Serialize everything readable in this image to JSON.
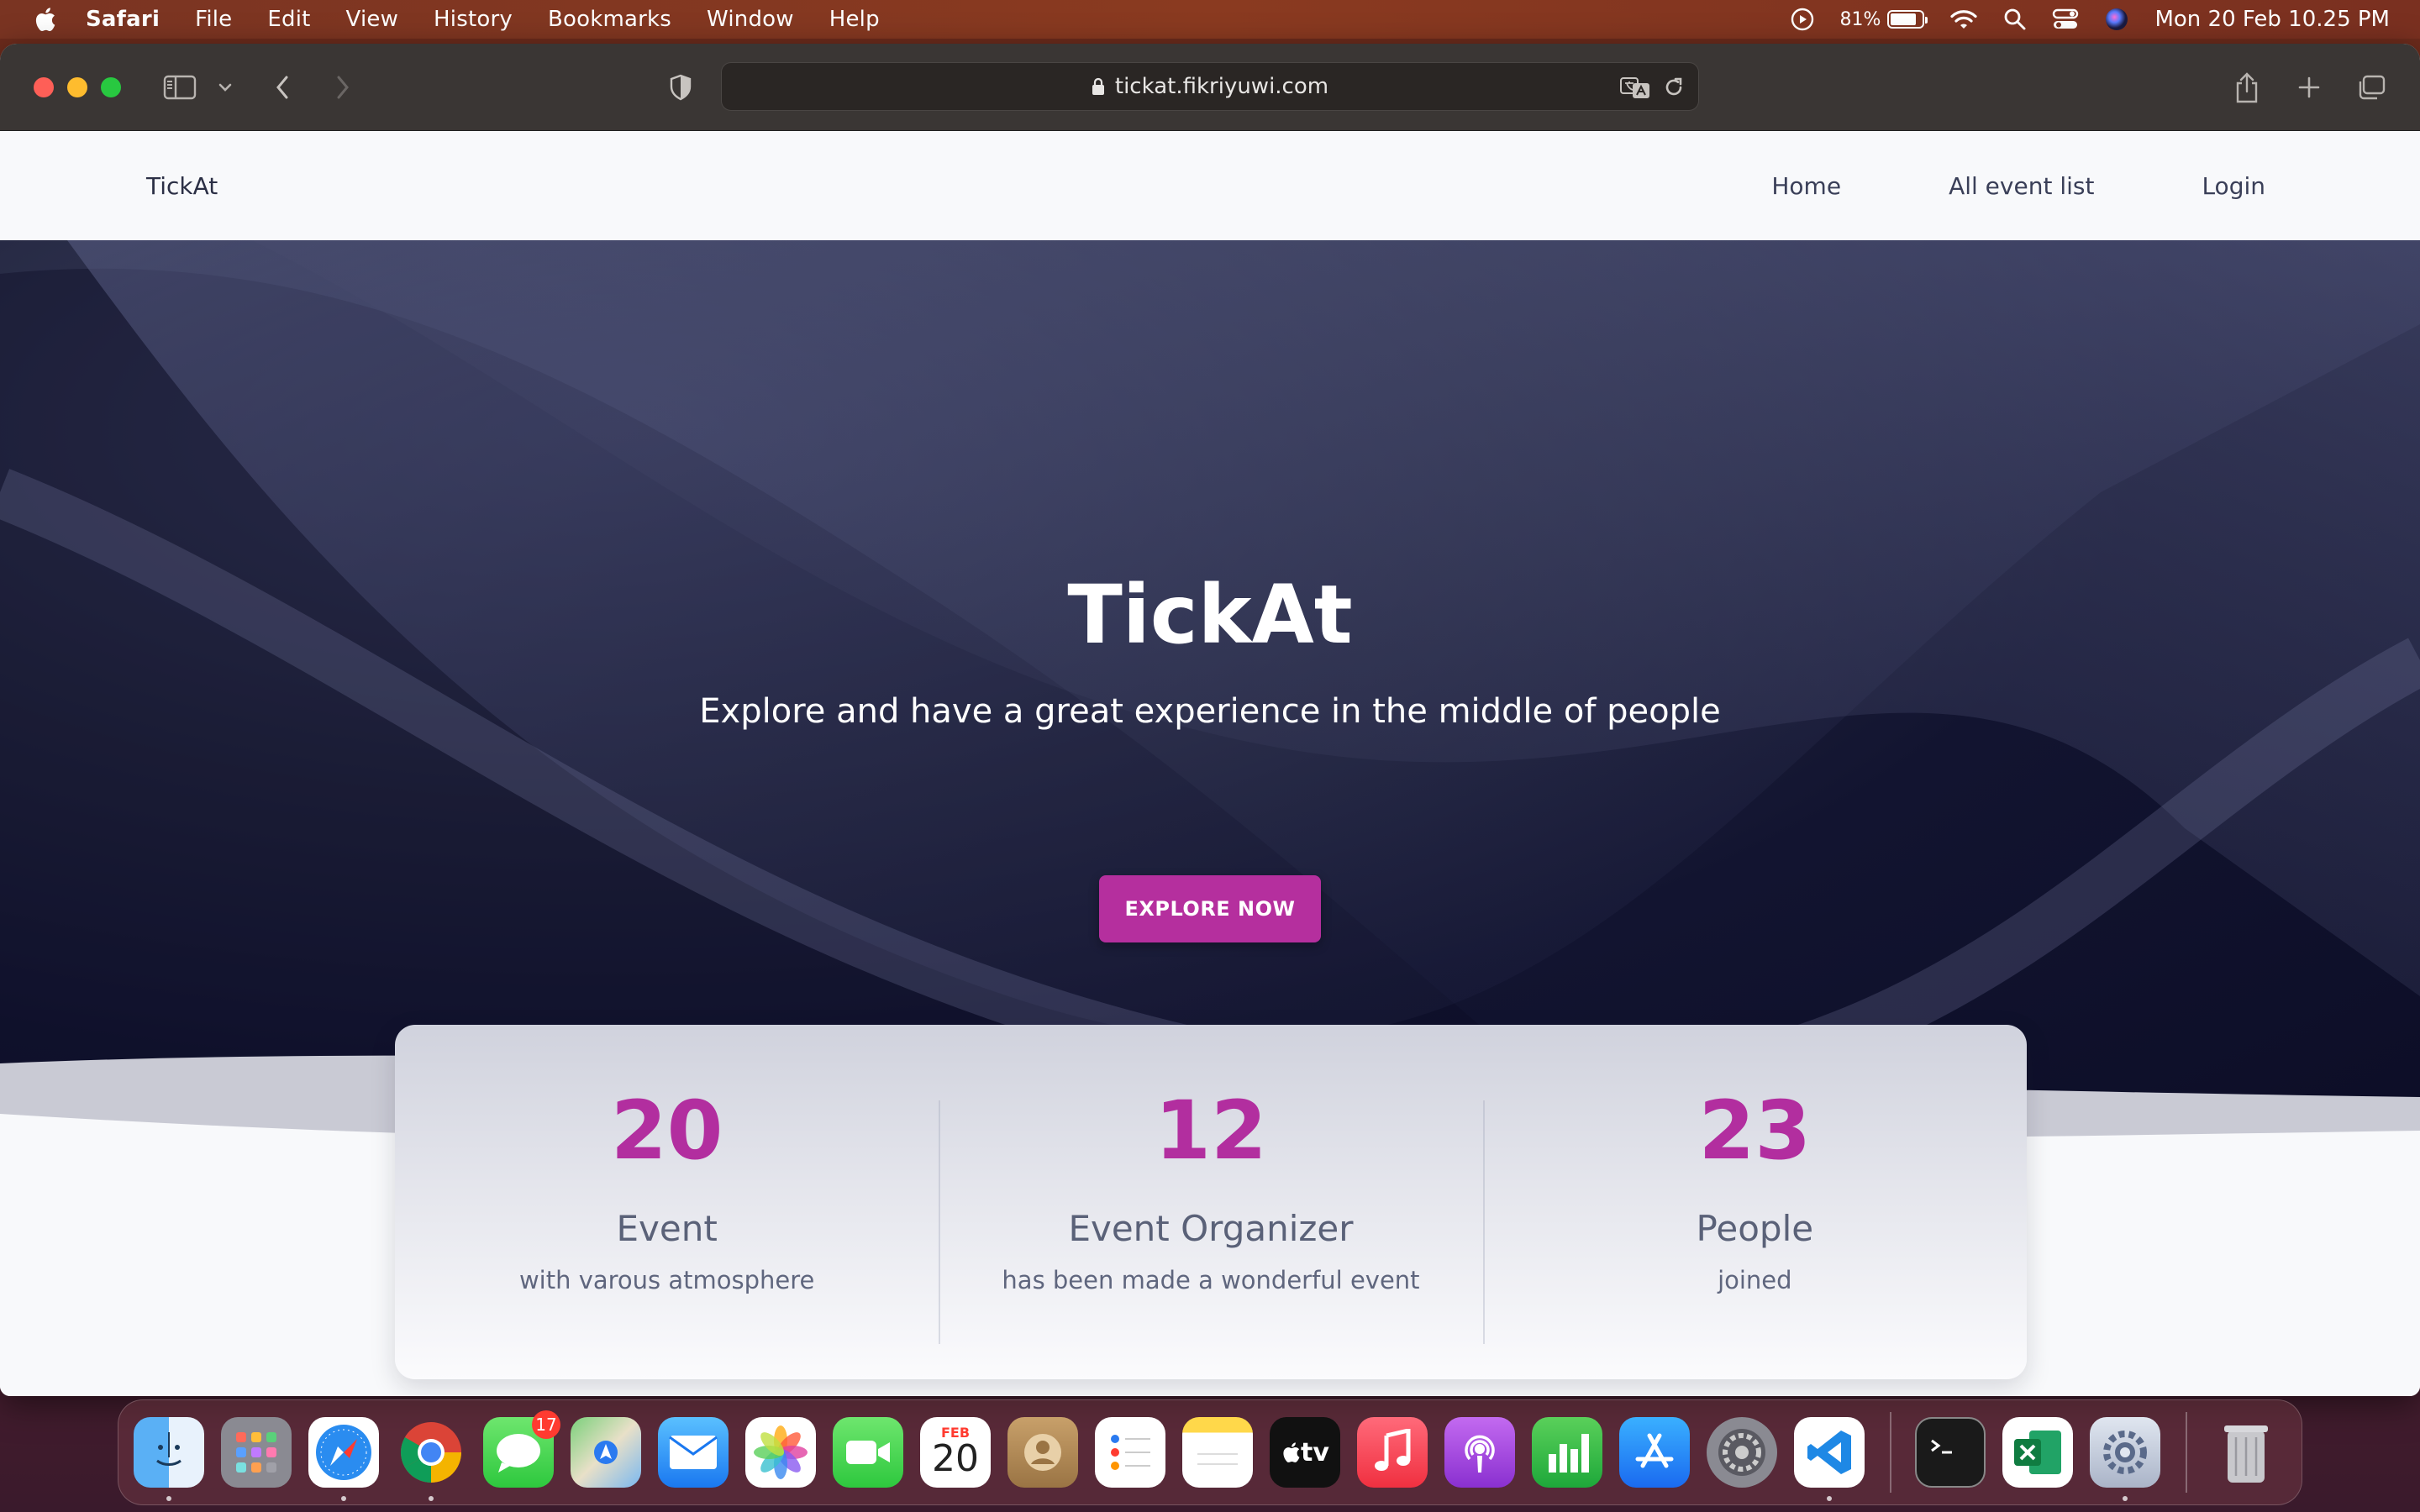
{
  "menubar": {
    "app_name": "Safari",
    "menus": [
      "File",
      "Edit",
      "View",
      "History",
      "Bookmarks",
      "Window",
      "Help"
    ],
    "battery_percent": "81%",
    "battery_level": 0.81,
    "datetime": "Mon 20 Feb  10.25 PM"
  },
  "browser": {
    "url": "tickat.fikriyuwi.com"
  },
  "site": {
    "brand": "TickAt",
    "nav": [
      {
        "label": "Home"
      },
      {
        "label": "All event list"
      },
      {
        "label": "Login"
      }
    ],
    "hero": {
      "title": "TickAt",
      "subtitle": "Explore and have a great experience in the middle of people",
      "button": "EXPLORE NOW"
    },
    "stats": [
      {
        "number": "20",
        "label": "Event",
        "desc": "with varous atmosphere"
      },
      {
        "number": "12",
        "label": "Event Organizer",
        "desc": "has been made a wonderful event"
      },
      {
        "number": "23",
        "label": "People",
        "desc": "joined"
      }
    ],
    "colors": {
      "accent": "#b52f9e",
      "hero_bg": "#121430",
      "stat_number": "#b22e9f"
    }
  },
  "dock": {
    "apps": [
      "Finder",
      "Launchpad",
      "Safari",
      "Chrome",
      "Messages",
      "Maps",
      "Mail",
      "Photos",
      "FaceTime",
      "Calendar",
      "Contacts",
      "Reminders",
      "Notes",
      "Apple TV",
      "Music",
      "Podcasts",
      "Numbers",
      "App Store",
      "System Settings",
      "VS Code",
      "Terminal",
      "Excel",
      "Settings Helper",
      "Trash"
    ],
    "messages_badge": "17",
    "calendar_month": "FEB",
    "calendar_day": "20",
    "tv_label": "tv"
  }
}
